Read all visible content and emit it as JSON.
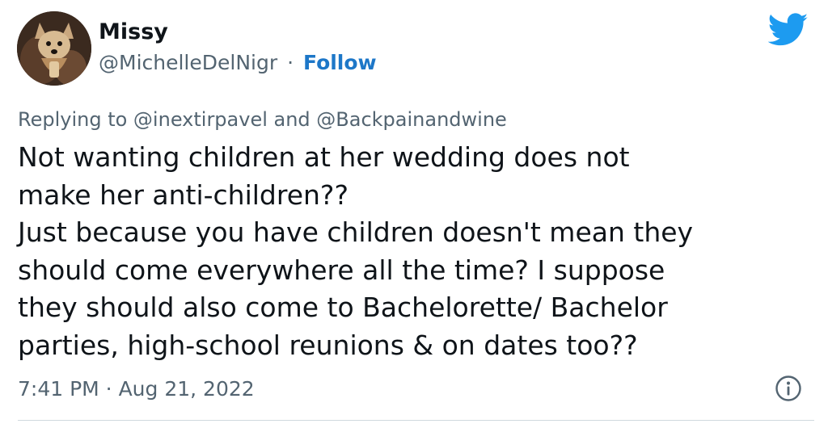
{
  "tweet": {
    "author": {
      "display_name": "Missy",
      "handle": "@MichelleDelNigr",
      "separator": "·",
      "follow_label": "Follow",
      "avatar_icon": "avatar-dog-photo"
    },
    "brand_icon": "twitter-bird-icon",
    "reply_to": "Replying to @inextirpavel and @Backpainandwine",
    "text_lines": [
      "Not wanting children at her wedding does not",
      "make her anti-children??",
      "Just because you have children doesn't mean they",
      "should come everywhere all the time? I suppose",
      "they should also come to Bachelorette/ Bachelor",
      "parties, high-school reunions & on dates too??"
    ],
    "timestamp": "7:41 PM · Aug 21, 2022",
    "info_icon": "info-icon"
  },
  "colors": {
    "text_primary": "#0f1419",
    "text_secondary": "#536471",
    "link": "#1d77c8",
    "brand": "#1d9bf0",
    "divider": "#cfd9de"
  }
}
